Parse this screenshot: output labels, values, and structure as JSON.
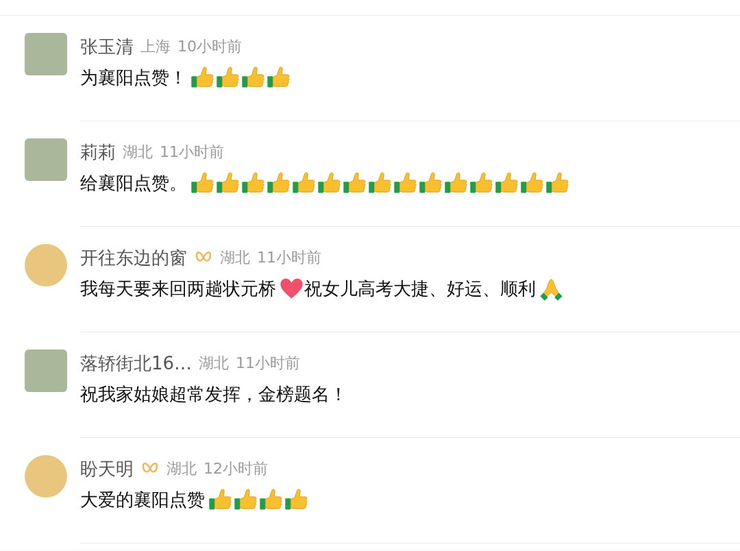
{
  "comments": [
    {
      "name": "张玉清",
      "badge": false,
      "location": "上海",
      "time": "10小时前",
      "avatar": {
        "kind": "rounded"
      },
      "content": [
        {
          "kind": "text",
          "text": "为襄阳点赞！"
        },
        {
          "kind": "thumbs_up"
        },
        {
          "kind": "thumbs_up"
        },
        {
          "kind": "thumbs_up"
        },
        {
          "kind": "thumbs_up"
        }
      ]
    },
    {
      "name": "莉莉",
      "badge": false,
      "location": "湖北",
      "time": "11小时前",
      "avatar": {
        "kind": "rounded"
      },
      "content": [
        {
          "kind": "text",
          "text": "给襄阳点赞。"
        },
        {
          "kind": "thumbs_up"
        },
        {
          "kind": "thumbs_up"
        },
        {
          "kind": "thumbs_up"
        },
        {
          "kind": "thumbs_up"
        },
        {
          "kind": "thumbs_up"
        },
        {
          "kind": "thumbs_up"
        },
        {
          "kind": "thumbs_up"
        },
        {
          "kind": "thumbs_up"
        },
        {
          "kind": "thumbs_up"
        },
        {
          "kind": "thumbs_up"
        },
        {
          "kind": "thumbs_up"
        },
        {
          "kind": "thumbs_up"
        },
        {
          "kind": "thumbs_up"
        },
        {
          "kind": "thumbs_up"
        },
        {
          "kind": "thumbs_up"
        }
      ]
    },
    {
      "name": "开往东边的窗",
      "badge": true,
      "location": "湖北",
      "time": "11小时前",
      "avatar": {
        "kind": "circle"
      },
      "content": [
        {
          "kind": "text",
          "text": "我每天要来回两趟状元桥"
        },
        {
          "kind": "heart"
        },
        {
          "kind": "text",
          "text": "祝女儿高考大捷、好运、顺利"
        },
        {
          "kind": "praying_hands"
        }
      ]
    },
    {
      "name": "落轿街北16…",
      "badge": false,
      "location": "湖北",
      "time": "11小时前",
      "avatar": {
        "kind": "rounded"
      },
      "content": [
        {
          "kind": "text",
          "text": "祝我家姑娘超常发挥，金榜题名！"
        }
      ]
    },
    {
      "name": "盼天明",
      "badge": true,
      "location": "湖北",
      "time": "12小时前",
      "avatar": {
        "kind": "circle"
      },
      "content": [
        {
          "kind": "text",
          "text": "大爱的襄阳点赞"
        },
        {
          "kind": "thumbs_up"
        },
        {
          "kind": "thumbs_up"
        },
        {
          "kind": "thumbs_up"
        },
        {
          "kind": "thumbs_up"
        }
      ]
    }
  ]
}
